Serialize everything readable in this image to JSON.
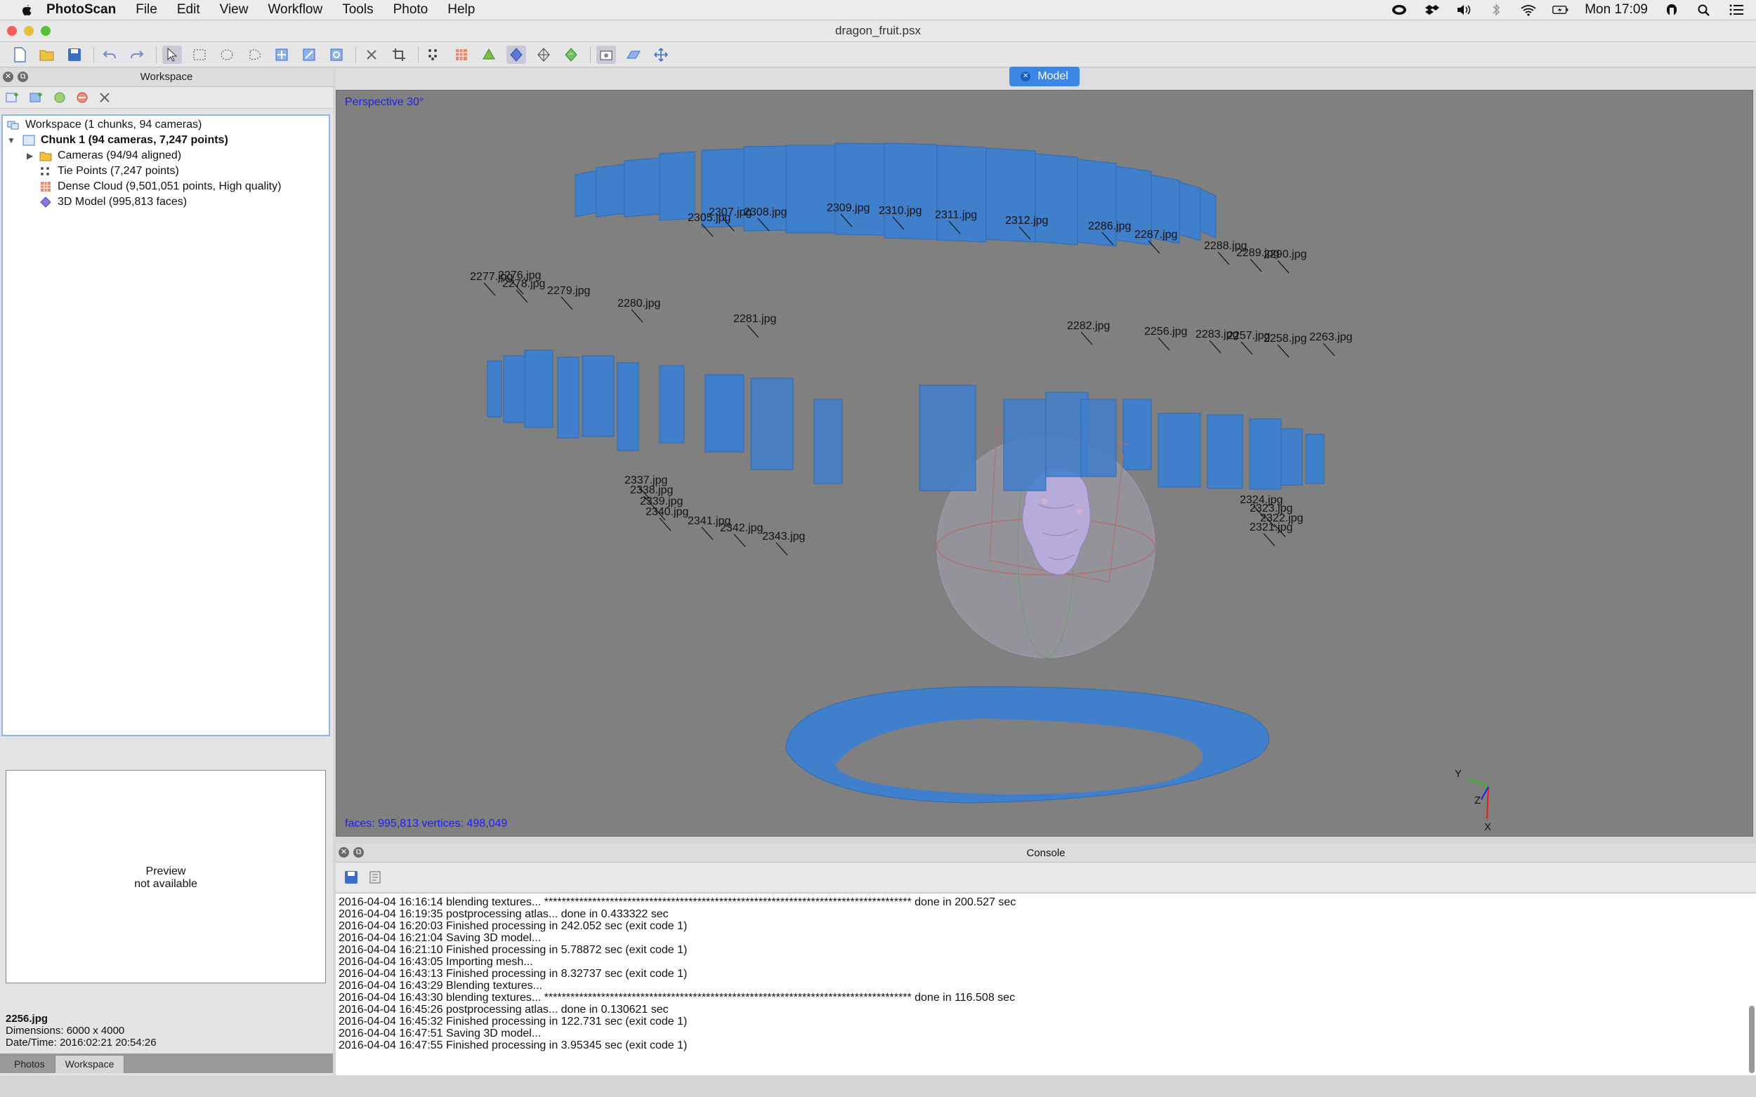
{
  "menubar": {
    "app_name": "PhotoScan",
    "items": [
      "File",
      "Edit",
      "View",
      "Workflow",
      "Tools",
      "Photo",
      "Help"
    ],
    "clock": "Mon 17:09"
  },
  "window": {
    "title": "dragon_fruit.psx"
  },
  "workspace_panel": {
    "title": "Workspace",
    "tree": [
      {
        "label": "Workspace (1 chunks, 94 cameras)",
        "level": 0,
        "bold": false,
        "icon": "workspace-icon"
      },
      {
        "label": "Chunk 1 (94 cameras, 7,247 points)",
        "level": 1,
        "bold": true,
        "icon": "chunk-icon",
        "expanded": true
      },
      {
        "label": "Cameras (94/94 aligned)",
        "level": 2,
        "bold": false,
        "icon": "folder-icon",
        "expandable": true
      },
      {
        "label": "Tie Points (7,247 points)",
        "level": 2,
        "bold": false,
        "icon": "tie-points-icon"
      },
      {
        "label": "Dense Cloud (9,501,051 points, High quality)",
        "level": 2,
        "bold": false,
        "icon": "dense-cloud-icon"
      },
      {
        "label": "3D Model (995,813 faces)",
        "level": 2,
        "bold": false,
        "icon": "model-icon"
      }
    ],
    "preview": {
      "line1": "Preview",
      "line2": "not available"
    },
    "photo_info": {
      "filename": "2256.jpg",
      "dimensions": "Dimensions: 6000 x 4000",
      "datetime": "Date/Time: 2016:02:21 20:54:26"
    },
    "tabs": [
      "Photos",
      "Workspace"
    ]
  },
  "model_view": {
    "tab_label": "Model",
    "projection": "Perspective 30°",
    "stats": "faces: 995,813 vertices: 498,049",
    "axes": {
      "y": "Y",
      "z": "Z",
      "x": "X"
    },
    "camera_labels": [
      "2307.jpg",
      "2308.jpg",
      "2309.jpg",
      "2310.jpg",
      "2311.jpg",
      "2312.jpg",
      "2286.jpg",
      "2287.jpg",
      "2288.jpg",
      "2289.jpg",
      "2290.jpg",
      "2305.jpg",
      "2277.jpg",
      "2276.jpg",
      "2278.jpg",
      "2279.jpg",
      "2280.jpg",
      "2281.jpg",
      "2282.jpg",
      "2256.jpg",
      "2283.jpg",
      "2257.jpg",
      "2258.jpg",
      "2263.jpg",
      "2337.jpg",
      "2338.jpg",
      "2339.jpg",
      "2340.jpg",
      "2341.jpg",
      "2342.jpg",
      "2343.jpg",
      "2324.jpg",
      "2323.jpg",
      "2322.jpg",
      "2321.jpg"
    ]
  },
  "console": {
    "title": "Console",
    "lines": [
      "2016-04-04 16:16:14 blending textures... ************************************************************************************ done in 200.527 sec",
      "2016-04-04 16:19:35 postprocessing atlas... done in 0.433322 sec",
      "2016-04-04 16:20:03 Finished processing in 242.052 sec (exit code 1)",
      "2016-04-04 16:21:04 Saving 3D model...",
      "2016-04-04 16:21:10 Finished processing in 5.78872 sec (exit code 1)",
      "2016-04-04 16:43:05 Importing mesh...",
      "2016-04-04 16:43:13 Finished processing in 8.32737 sec (exit code 1)",
      "2016-04-04 16:43:29 Blending textures...",
      "2016-04-04 16:43:30 blending textures... ************************************************************************************ done in 116.508 sec",
      "2016-04-04 16:45:26 postprocessing atlas... done in 0.130621 sec",
      "2016-04-04 16:45:32 Finished processing in 122.731 sec (exit code 1)",
      "2016-04-04 16:47:51 Saving 3D model...",
      "2016-04-04 16:47:55 Finished processing in 3.95345 sec (exit code 1)"
    ]
  },
  "colors": {
    "accent": "#3b86e6",
    "camera_plane": "#3f7fcc",
    "viewport_bg": "#808080",
    "info_text": "#1c1cff"
  }
}
